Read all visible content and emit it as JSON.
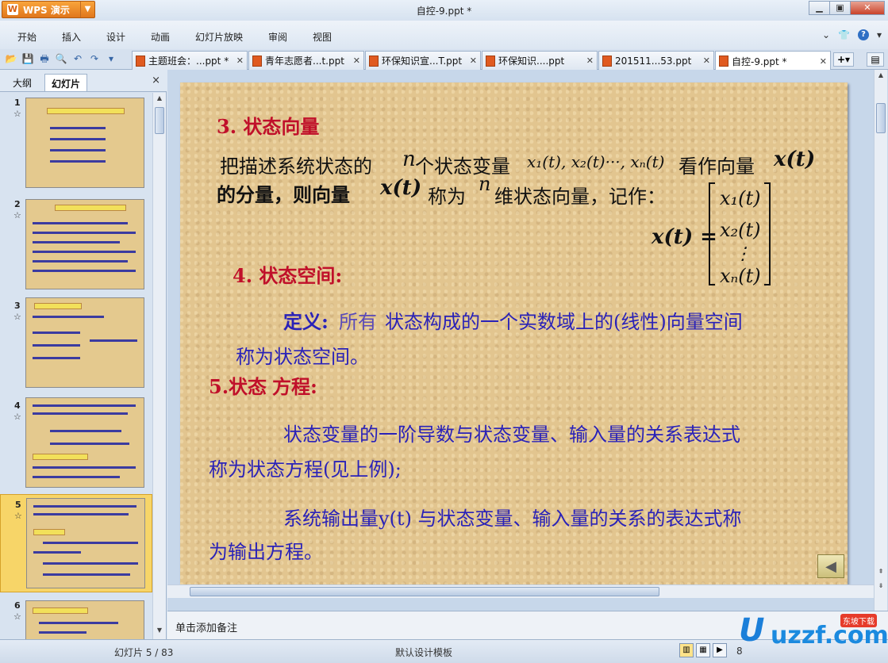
{
  "app": {
    "name": "WPS 演示",
    "window_title": "自控-9.ppt *"
  },
  "menu": [
    "开始",
    "插入",
    "设计",
    "动画",
    "幻灯片放映",
    "审阅",
    "视图"
  ],
  "doc_tabs": [
    {
      "label": "主题班会：...ppt *"
    },
    {
      "label": "青年志愿者...t.ppt"
    },
    {
      "label": "环保知识宣...T.ppt"
    },
    {
      "label": "环保知识....ppt"
    },
    {
      "label": "201511...53.ppt"
    },
    {
      "label": "自控-9.ppt *"
    }
  ],
  "left_pane": {
    "tab_outline": "大纲",
    "tab_slides": "幻灯片",
    "close": "×"
  },
  "thumbnails": [
    {
      "num": "1",
      "star": "☆"
    },
    {
      "num": "2",
      "star": "☆"
    },
    {
      "num": "3",
      "star": "☆"
    },
    {
      "num": "4",
      "star": "☆"
    },
    {
      "num": "5",
      "star": "☆"
    },
    {
      "num": "6",
      "star": "☆"
    }
  ],
  "slide": {
    "h3": "3. 状态向量",
    "p1a": "把描述系统状态的",
    "p1_n": "n",
    "p1b": "个状态变量",
    "p1_vars": "x₁(t), x₂(t)···, xₙ(t)",
    "p1c": "看作向量",
    "p1_xt": "x(t)",
    "p2a": "的分量，则向量",
    "p2_xt": "x(t)",
    "p2b": "称为",
    "p2_n": "n",
    "p2c": "维状态向量，记作：",
    "eq_lhs": "x(t) =",
    "vec": [
      "x₁(t)",
      "x₂(t)",
      "⋮",
      "xₙ(t)"
    ],
    "h4": "4. 状态空间:",
    "def_label": "定义:",
    "def_1": "所有",
    "def_2": "状态构成的一个实数域上的(线性)向量空间",
    "def_3": "称为状态空间。",
    "h5a": "5.状态",
    "h5b": "方程:",
    "p5a": "状态变量的一阶导数与状态变量、输入量的关系表达式",
    "p5b": "称为状态方程(见上例);",
    "p6a": "系统输出量y(t) 与状态变量、输入量的关系的表达式称",
    "p6b": "为输出方程。"
  },
  "notes_placeholder": "单击添加备注",
  "status": {
    "slide_counter": "幻灯片 5 / 83",
    "template": "默认设计模板",
    "zoom": "8"
  },
  "watermark": {
    "text": "uzzf.com",
    "tag": "东坡下载"
  }
}
